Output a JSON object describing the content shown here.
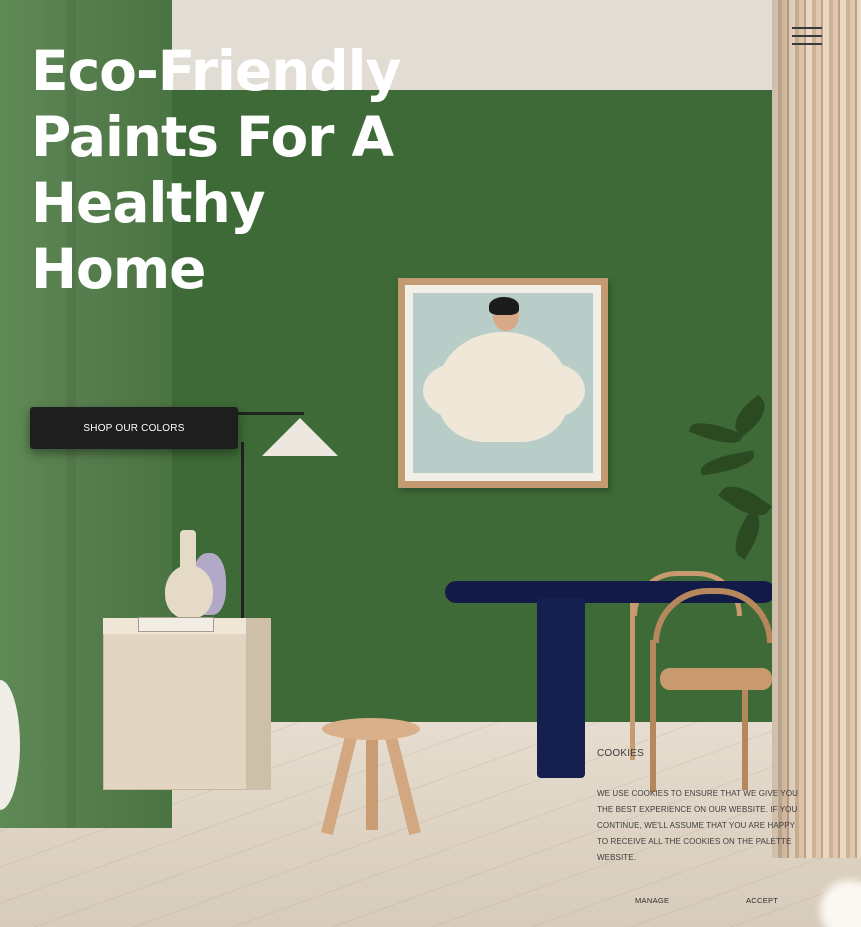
{
  "header": {
    "menu_icon": "hamburger-menu-icon"
  },
  "hero": {
    "title": "Eco-Friendly Paints For A Healthy Home",
    "cta_label": "SHOP OUR COLORS"
  },
  "cookie_banner": {
    "title": "COOKIES",
    "text": "WE USE COOKIES TO ENSURE THAT WE GIVE YOU THE BEST EXPERIENCE ON OUR WEBSITE. IF YOU CONTINUE, WE'LL ASSUME THAT YOU ARE HAPPY TO RECEIVE ALL THE COOKIES ON THE PALETTE WEBSITE.",
    "manage_label": "MANAGE",
    "accept_label": "ACCEPT"
  },
  "colors": {
    "wall_green": "#3d6a37",
    "cta_background": "#1e1e1e",
    "title_text": "#ffffff"
  }
}
